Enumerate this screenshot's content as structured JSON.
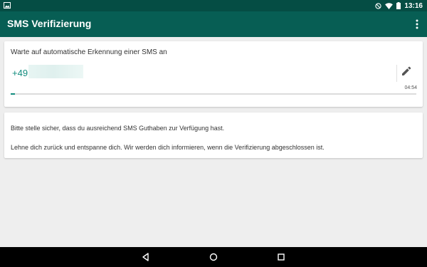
{
  "status_bar": {
    "time": "13:16",
    "icons": [
      "image-notification-icon",
      "do-not-disturb-icon",
      "wifi-icon",
      "battery-icon"
    ]
  },
  "app_bar": {
    "title": "SMS Verifizierung",
    "menu_icon": "more-vert-icon"
  },
  "verification_card": {
    "prompt": "Warte auf automatische Erkennung einer SMS an",
    "country_code": "+49",
    "timer": "04:54",
    "progress_fraction": 0.01,
    "edit_icon": "pencil-icon"
  },
  "info_card": {
    "line1": "Bitte stelle sicher, dass du ausreichend SMS Guthaben zur Verfügung hast.",
    "line2": "Lehne dich zurück und entspanne dich. Wir werden dich informieren, wenn die Verifizierung abgeschlossen ist."
  },
  "nav_bar": {
    "buttons": [
      "back-icon",
      "home-icon",
      "recents-icon"
    ]
  },
  "colors": {
    "status_bar": "#054d44",
    "app_bar": "#075e54",
    "accent": "#128c7e",
    "background": "#eeeeee"
  }
}
